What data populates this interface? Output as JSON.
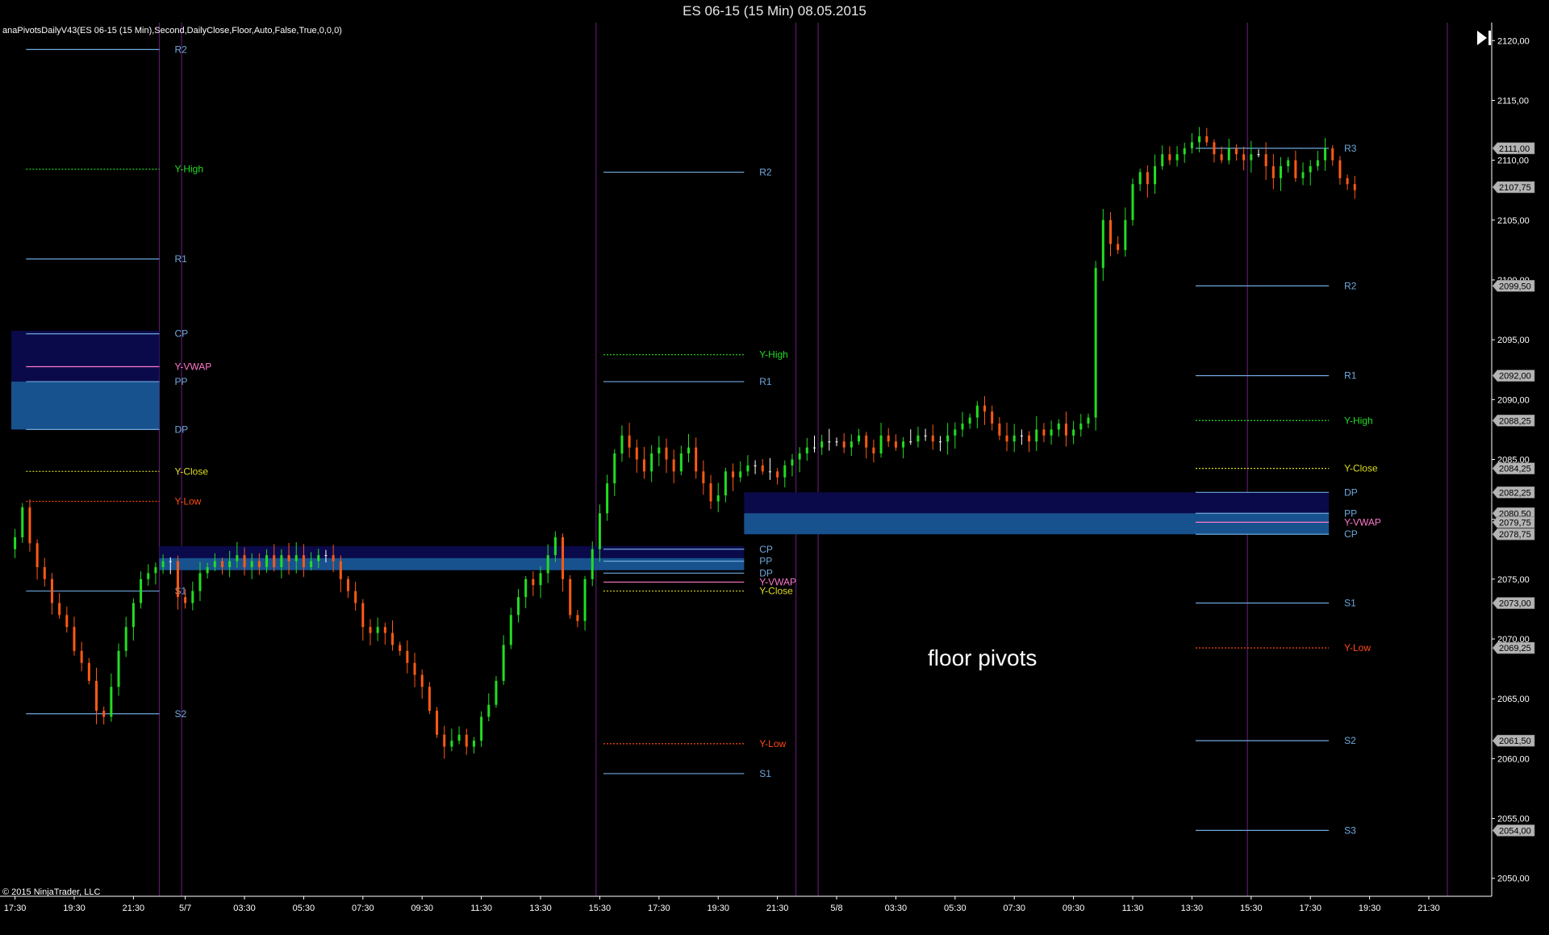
{
  "window": {
    "title": "ES 06-15 (15 Min)  08.05.2015"
  },
  "indicator_label": "anaPivotsDailyV43(ES 06-15 (15 Min),Second,DailyClose,Floor,Auto,False,True,0,0,0)",
  "copyright": "© 2015 NinjaTrader, LLC",
  "annotation": "floor pivots",
  "colors": {
    "background": "#000000",
    "up_bar": "#22dd22",
    "down_bar": "#ff5a14",
    "doji_bar": "#ffffff",
    "pivot_line": "#6fa8dc",
    "y_high": "#22dd22",
    "y_close": "#dddd22",
    "y_low": "#ff4a14",
    "y_vwap": "#ff77cc",
    "session_line": "#5a1a6a",
    "band_dark": "#0a0a4a",
    "band_light": "#1a5a96",
    "price_tag": "#b4b4b4"
  },
  "chart_data": {
    "type": "candlestick",
    "title": "ES 06-15 (15 Min)  08.05.2015",
    "ylim": [
      2048.5,
      2121.5
    ],
    "y_ticks": [
      "2120,00",
      "2115,00",
      "2110,00",
      "2105,00",
      "2100,00",
      "2095,00",
      "2090,00",
      "2085,00",
      "2080,00",
      "2075,00",
      "2070,00",
      "2065,00",
      "2060,00",
      "2055,00",
      "2050,00"
    ],
    "x_ticks": [
      {
        "label": "17:30",
        "i": 0
      },
      {
        "label": "19:30",
        "i": 8
      },
      {
        "label": "21:30",
        "i": 16
      },
      {
        "label": "5/7",
        "i": 23
      },
      {
        "label": "03:30",
        "i": 31
      },
      {
        "label": "05:30",
        "i": 39
      },
      {
        "label": "07:30",
        "i": 47
      },
      {
        "label": "09:30",
        "i": 55
      },
      {
        "label": "11:30",
        "i": 63
      },
      {
        "label": "13:30",
        "i": 71
      },
      {
        "label": "15:30",
        "i": 79
      },
      {
        "label": "17:30",
        "i": 87
      },
      {
        "label": "19:30",
        "i": 95
      },
      {
        "label": "21:30",
        "i": 103
      },
      {
        "label": "5/8",
        "i": 111
      },
      {
        "label": "03:30",
        "i": 119
      },
      {
        "label": "05:30",
        "i": 127
      },
      {
        "label": "07:30",
        "i": 135
      },
      {
        "label": "09:30",
        "i": 143
      },
      {
        "label": "11:30",
        "i": 151
      },
      {
        "label": "13:30",
        "i": 159
      },
      {
        "label": "15:30",
        "i": 167
      },
      {
        "label": "17:30",
        "i": 175
      },
      {
        "label": "19:30",
        "i": 183
      },
      {
        "label": "21:30",
        "i": 191
      }
    ],
    "x_first": 0,
    "x_last": 199,
    "session_lines": [
      20,
      23,
      79,
      106,
      109,
      167,
      194
    ],
    "closes": [
      2078.5,
      2081.0,
      2078.0,
      2076.0,
      2075.0,
      2073.0,
      2072.0,
      2071.0,
      2069.0,
      2068.0,
      2066.5,
      2064.0,
      2063.5,
      2066.0,
      2069.0,
      2071.0,
      2073.0,
      2075.0,
      2075.5,
      2076.0,
      2076.5,
      2076.5,
      2073.5,
      2073.0,
      2074.0,
      2075.5,
      2076.0,
      2076.5,
      2076.0,
      2076.5,
      2077.0,
      2076.0,
      2076.5,
      2076.0,
      2077.0,
      2076.0,
      2077.0,
      2076.5,
      2077.0,
      2076.0,
      2076.5,
      2077.0,
      2077.0,
      2076.5,
      2075.0,
      2074.0,
      2073.0,
      2071.0,
      2070.5,
      2071.0,
      2070.5,
      2069.5,
      2069.0,
      2068.0,
      2067.0,
      2066.0,
      2064.0,
      2062.0,
      2061.0,
      2061.5,
      2062.0,
      2061.0,
      2061.5,
      2063.5,
      2064.5,
      2066.5,
      2069.5,
      2072.0,
      2073.5,
      2075.0,
      2074.5,
      2075.5,
      2077.0,
      2078.5,
      2075.0,
      2072.0,
      2071.5,
      2075.0,
      2077.5,
      2080.5,
      2083.0,
      2085.5,
      2087.0,
      2086.0,
      2085.0,
      2084.0,
      2085.5,
      2086.0,
      2085.0,
      2084.0,
      2085.5,
      2086.0,
      2084.0,
      2083.0,
      2081.5,
      2082.0,
      2084.0,
      2083.5,
      2084.0,
      2084.5,
      2084.5,
      2084.0,
      2084.0,
      2083.5,
      2084.5,
      2085.0,
      2085.5,
      2086.0,
      2086.0,
      2086.5,
      2086.5,
      2086.5,
      2086.0,
      2086.5,
      2087.0,
      2086.0,
      2085.5,
      2087.0,
      2086.5,
      2086.0,
      2086.5,
      2086.5,
      2087.0,
      2087.0,
      2086.5,
      2086.5,
      2087.0,
      2087.5,
      2088.0,
      2088.5,
      2089.5,
      2089.0,
      2088.0,
      2087.0,
      2086.5,
      2087.0,
      2087.0,
      2086.5,
      2087.5,
      2087.0,
      2087.5,
      2088.0,
      2087.0,
      2087.5,
      2088.0,
      2088.5,
      2101.0,
      2105.0,
      2103.0,
      2102.5,
      2105.0,
      2108.0,
      2109.0,
      2108.0,
      2109.5,
      2110.5,
      2110.0,
      2110.5,
      2111.0,
      2111.5,
      2112.0,
      2111.5,
      2110.5,
      2110.0,
      2111.0,
      2110.5,
      2110.0,
      2110.5,
      2110.5,
      2109.5,
      2108.5,
      2109.5,
      2110.0,
      2108.5,
      2109.0,
      2109.5,
      2110.0,
      2111.0,
      2110.0,
      2108.5,
      2108.0,
      2107.5
    ],
    "levels": [
      {
        "x0": 2,
        "x1": 19,
        "price": 2119.25,
        "label": "R2",
        "style": "pivot_line",
        "lx": 22
      },
      {
        "x0": 2,
        "x1": 19,
        "price": 2109.25,
        "label": "Y-High",
        "style": "y_high",
        "dash": true,
        "lx": 22
      },
      {
        "x0": 2,
        "x1": 19,
        "price": 2101.75,
        "label": "R1",
        "style": "pivot_line",
        "lx": 22
      },
      {
        "x0": 2,
        "x1": 19,
        "price": 2095.5,
        "label": "CP",
        "style": "pivot_line",
        "lx": 22
      },
      {
        "x0": 2,
        "x1": 19,
        "price": 2092.75,
        "label": "Y-VWAP",
        "style": "y_vwap",
        "lx": 22
      },
      {
        "x0": 2,
        "x1": 19,
        "price": 2091.5,
        "label": "PP",
        "style": "pivot_line",
        "lx": 22
      },
      {
        "x0": 2,
        "x1": 19,
        "price": 2087.5,
        "label": "DP",
        "style": "pivot_line",
        "lx": 22
      },
      {
        "x0": 2,
        "x1": 19,
        "price": 2084.0,
        "label": "Y-Close",
        "style": "y_close",
        "dash": true,
        "lx": 22
      },
      {
        "x0": 2,
        "x1": 19,
        "price": 2081.5,
        "label": "Y-Low",
        "style": "y_low",
        "dash": true,
        "lx": 22
      },
      {
        "x0": 2,
        "x1": 19,
        "price": 2074.0,
        "label": "S1",
        "style": "pivot_line",
        "lx": 22
      },
      {
        "x0": 2,
        "x1": 19,
        "price": 2063.75,
        "label": "S2",
        "style": "pivot_line",
        "lx": 22
      },
      {
        "x0": 80,
        "x1": 98,
        "price": 2109.0,
        "label": "R2",
        "style": "pivot_line",
        "lx": 101
      },
      {
        "x0": 80,
        "x1": 98,
        "price": 2093.75,
        "label": "Y-High",
        "style": "y_high",
        "dash": true,
        "lx": 101
      },
      {
        "x0": 80,
        "x1": 98,
        "price": 2091.5,
        "label": "R1",
        "style": "pivot_line",
        "lx": 101
      },
      {
        "x0": 80,
        "x1": 98,
        "price": 2077.5,
        "label": "CP",
        "style": "pivot_line",
        "lx": 101
      },
      {
        "x0": 80,
        "x1": 98,
        "price": 2076.5,
        "label": "PP",
        "style": "pivot_line",
        "lx": 101
      },
      {
        "x0": 80,
        "x1": 98,
        "price": 2075.5,
        "label": "DP",
        "style": "pivot_line",
        "lx": 101
      },
      {
        "x0": 80,
        "x1": 98,
        "price": 2074.75,
        "label": "Y-VWAP",
        "style": "y_vwap",
        "lx": 101
      },
      {
        "x0": 80,
        "x1": 98,
        "price": 2074.0,
        "label": "Y-Close",
        "style": "y_close",
        "dash": true,
        "lx": 101
      },
      {
        "x0": 80,
        "x1": 98,
        "price": 2061.25,
        "label": "Y-Low",
        "style": "y_low",
        "dash": true,
        "lx": 101
      },
      {
        "x0": 80,
        "x1": 98,
        "price": 2058.75,
        "label": "S1",
        "style": "pivot_line",
        "lx": 101
      },
      {
        "x0": 160,
        "x1": 177,
        "price": 2111.0,
        "label": "R3",
        "style": "pivot_line",
        "lx": 180
      },
      {
        "x0": 160,
        "x1": 177,
        "price": 2099.5,
        "label": "R2",
        "style": "pivot_line",
        "lx": 180
      },
      {
        "x0": 160,
        "x1": 177,
        "price": 2092.0,
        "label": "R1",
        "style": "pivot_line",
        "lx": 180
      },
      {
        "x0": 160,
        "x1": 177,
        "price": 2088.25,
        "label": "Y-High",
        "style": "y_high",
        "dash": true,
        "lx": 180
      },
      {
        "x0": 160,
        "x1": 177,
        "price": 2084.25,
        "label": "Y-Close",
        "style": "y_close",
        "dash": true,
        "lx": 180
      },
      {
        "x0": 160,
        "x1": 177,
        "price": 2082.25,
        "label": "DP",
        "style": "pivot_line",
        "lx": 180
      },
      {
        "x0": 160,
        "x1": 177,
        "price": 2080.5,
        "label": "PP",
        "style": "pivot_line",
        "lx": 180
      },
      {
        "x0": 160,
        "x1": 177,
        "price": 2079.75,
        "label": "Y-VWAP",
        "style": "y_vwap",
        "lx": 180
      },
      {
        "x0": 160,
        "x1": 177,
        "price": 2078.75,
        "label": "CP",
        "style": "pivot_line",
        "lx": 180
      },
      {
        "x0": 160,
        "x1": 177,
        "price": 2073.0,
        "label": "S1",
        "style": "pivot_line",
        "lx": 180
      },
      {
        "x0": 160,
        "x1": 177,
        "price": 2069.25,
        "label": "Y-Low",
        "style": "y_low",
        "dash": true,
        "lx": 180
      },
      {
        "x0": 160,
        "x1": 177,
        "price": 2061.5,
        "label": "S2",
        "style": "pivot_line",
        "lx": 180
      },
      {
        "x0": 160,
        "x1": 177,
        "price": 2054.0,
        "label": "S3",
        "style": "pivot_line",
        "lx": 180
      }
    ],
    "bands": [
      {
        "x0": 0,
        "x1": 19,
        "p_top": 2095.75,
        "p_bot": 2087.5,
        "p_split": 2091.5
      },
      {
        "x0": 20,
        "x1": 98,
        "p_top": 2077.75,
        "p_bot": 2075.75,
        "p_split": 2076.75
      },
      {
        "x0": 99,
        "x1": 177,
        "p_top": 2082.25,
        "p_bot": 2078.75,
        "p_split": 2080.5
      }
    ],
    "price_tags": [
      "2111,00",
      "2107,75",
      "2099,50",
      "2092,00",
      "2088,25",
      "2084,25",
      "2082,25",
      "2080,50",
      "2079,75",
      "2078,75",
      "2073,00",
      "2069,25",
      "2061,50",
      "2054,00"
    ]
  }
}
